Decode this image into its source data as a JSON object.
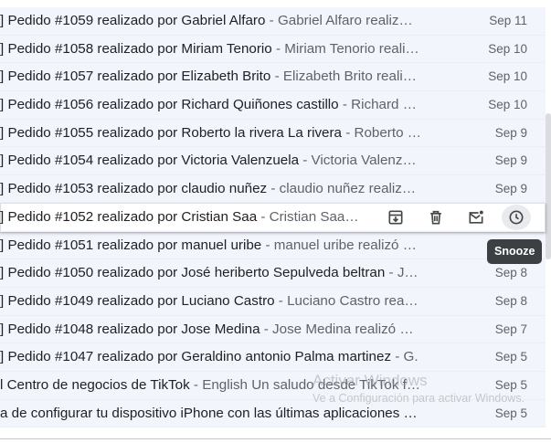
{
  "rows": [
    {
      "subject": "] Pedido #1059 realizado por Gabriel Alfaro",
      "snippet": "Gabriel Alfaro realiz…",
      "date": "Sep 11"
    },
    {
      "subject": "] Pedido #1058 realizado por Miriam Tenorio",
      "snippet": "Miriam Tenorio reali…",
      "date": "Sep 10"
    },
    {
      "subject": "] Pedido #1057 realizado por Elizabeth Brito",
      "snippet": "Elizabeth Brito reali…",
      "date": "Sep 10"
    },
    {
      "subject": "] Pedido #1056 realizado por Richard Quiñones castillo",
      "snippet": "Richard …",
      "date": "Sep 10"
    },
    {
      "subject": "] Pedido #1055 realizado por Roberto la rivera La rivera",
      "snippet": "Roberto …",
      "date": "Sep 9"
    },
    {
      "subject": "] Pedido #1054 realizado por Victoria Valenzuela",
      "snippet": "Victoria Valenz…",
      "date": "Sep 9"
    },
    {
      "subject": "] Pedido #1053 realizado por claudio nuñez",
      "snippet": "claudio nuñez realiz…",
      "date": "Sep 9"
    },
    {
      "subject": "] Pedido #1052 realizado por Cristian Saa",
      "snippet": "Cristian Saa…",
      "date": ""
    },
    {
      "subject": "] Pedido #1051 realizado por manuel uribe",
      "snippet": "manuel uribe realizó …",
      "date": ""
    },
    {
      "subject": "] Pedido #1050 realizado por José heriberto Sepulveda beltran",
      "snippet": "J…",
      "date": "Sep 8"
    },
    {
      "subject": "] Pedido #1049 realizado por Luciano Castro",
      "snippet": "Luciano Castro rea…",
      "date": "Sep 8"
    },
    {
      "subject": "] Pedido #1048 realizado por Jose Medina",
      "snippet": "Jose Medina realizó …",
      "date": "Sep 7"
    },
    {
      "subject": "] Pedido #1047 realizado por Geraldino antonio Palma martinez",
      "snippet": "G.",
      "date": "Sep 5"
    },
    {
      "subject": "l Centro de negocios de TikTok",
      "snippet": "English Un saludo desde TikTok f…",
      "date": "Sep 5"
    },
    {
      "subject": "a de configurar tu dispositivo iPhone con las últimas aplicaciones …",
      "snippet": "",
      "date": "Sep 5"
    }
  ],
  "separator": " - ",
  "hover_actions": {
    "archive": "archive-icon",
    "delete": "trash-icon",
    "mark_unread": "mark-unread-icon",
    "snooze": "clock-icon"
  },
  "tooltip": "Snooze",
  "watermark": {
    "title": "Activar Windows",
    "subtitle": "Ve a Configuración para activar Windows."
  },
  "colors": {
    "read_row_bg": "#f2f6fc",
    "hover_row_bg": "#ffffff",
    "text": "#202124",
    "muted": "#5f6368",
    "tooltip_bg": "#3c4043"
  }
}
